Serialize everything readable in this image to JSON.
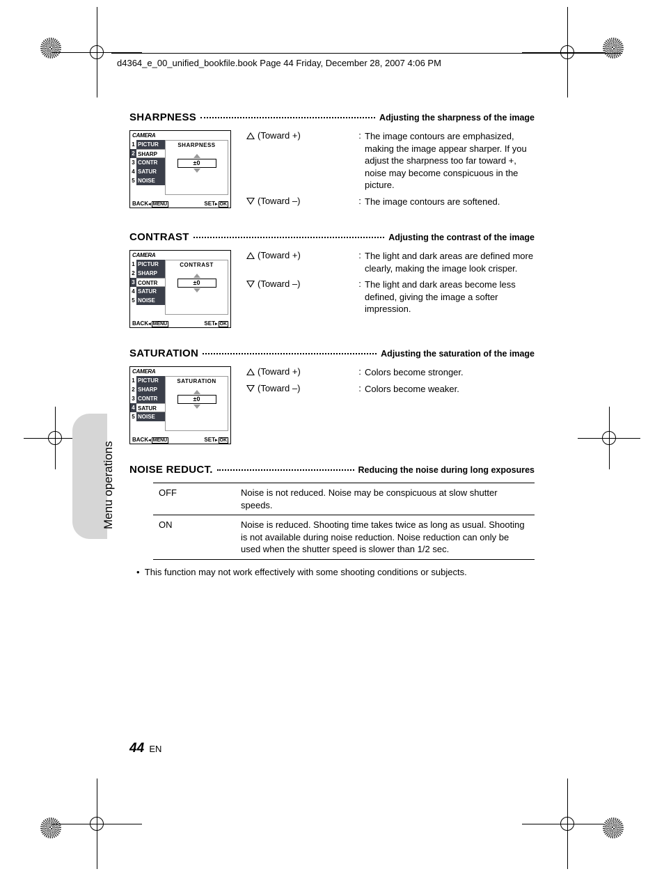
{
  "header": "d4364_e_00_unified_bookfile.book  Page 44  Friday, December 28, 2007  4:06 PM",
  "sideLabel": "Menu operations",
  "menus": {
    "titlebar": "CAMERA",
    "items": [
      "PICTUR",
      "SHARP",
      "CONTR",
      "SATUR",
      "NOISE"
    ],
    "value": "±0",
    "back": "BACK",
    "backChip": "MENU",
    "set": "SET",
    "setChip": "OK"
  },
  "sections": {
    "sharpness": {
      "title": "SHARPNESS",
      "subtitle": "Adjusting the sharpness of the image",
      "panel": "SHARPNESS",
      "selected": 2,
      "rows": [
        {
          "dir": "up",
          "label": "(Toward +)",
          "text": "The image contours are emphasized, making the image appear sharper. If you adjust the sharpness too far toward +, noise may become conspicuous in the picture."
        },
        {
          "dir": "down",
          "label": "(Toward –)",
          "text": "The image contours are softened."
        }
      ]
    },
    "contrast": {
      "title": "CONTRAST",
      "subtitle": "Adjusting the contrast of the image",
      "panel": "CONTRAST",
      "selected": 3,
      "rows": [
        {
          "dir": "up",
          "label": "(Toward +)",
          "text": "The light and dark areas are defined more clearly, making the image look crisper."
        },
        {
          "dir": "down",
          "label": "(Toward –)",
          "text": "The light and dark areas become less defined, giving the image a softer impression."
        }
      ]
    },
    "saturation": {
      "title": "SATURATION",
      "subtitle": "Adjusting the saturation of the image",
      "panel": "SATURATION",
      "selected": 4,
      "rows": [
        {
          "dir": "up",
          "label": "(Toward +)",
          "text": "Colors become stronger."
        },
        {
          "dir": "down",
          "label": "(Toward –)",
          "text": "Colors become weaker."
        }
      ]
    },
    "noise": {
      "title": "NOISE REDUCT.",
      "subtitle": "Reducing the noise during long exposures",
      "table": [
        {
          "k": "OFF",
          "v": "Noise is not reduced. Noise may be conspicuous at slow shutter speeds."
        },
        {
          "k": "ON",
          "v": "Noise is reduced. Shooting time takes twice as long as usual. Shooting is not available during noise reduction. Noise reduction can only be used when the shutter speed is slower than 1/2 sec."
        }
      ],
      "note": "This function may not work effectively with some shooting conditions or subjects."
    }
  },
  "footer": {
    "page": "44",
    "lang": "EN"
  }
}
